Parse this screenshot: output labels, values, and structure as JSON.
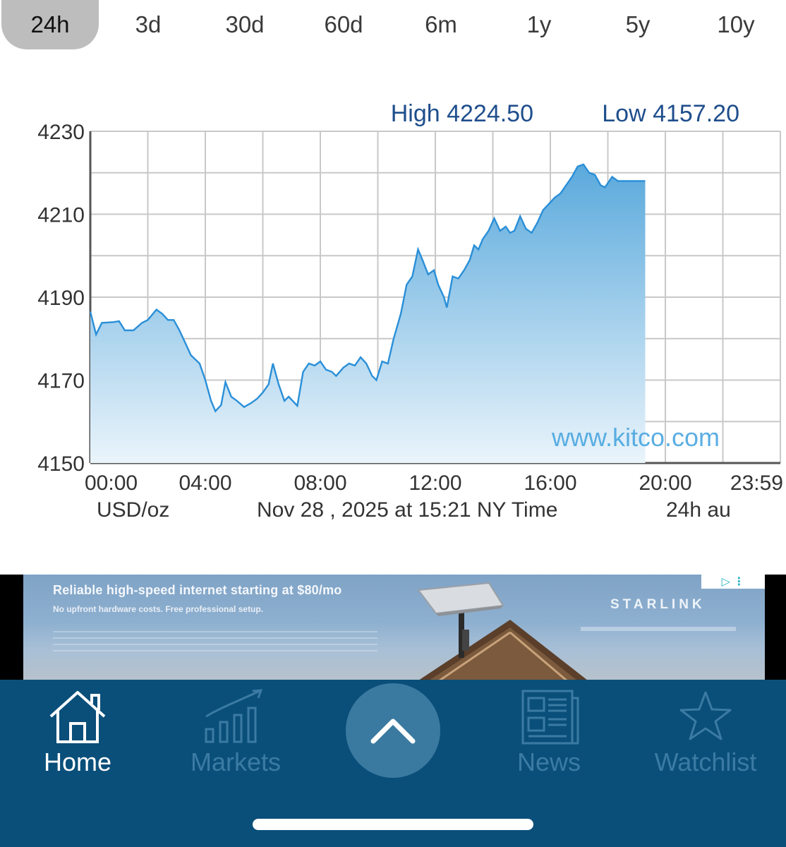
{
  "range_tabs": [
    {
      "label": "24h",
      "active": true
    },
    {
      "label": "3d",
      "active": false
    },
    {
      "label": "30d",
      "active": false
    },
    {
      "label": "60d",
      "active": false
    },
    {
      "label": "6m",
      "active": false
    },
    {
      "label": "1y",
      "active": false
    },
    {
      "label": "5y",
      "active": false
    },
    {
      "label": "10y",
      "active": false
    }
  ],
  "chart": {
    "high_label": "High 4224.50",
    "low_label": "Low 4157.20",
    "watermark": "www.kitco.com",
    "unit_label": "USD/oz",
    "timestamp_label": "Nov 28 , 2025 at 15:21 NY Time",
    "range_label": "24h au",
    "colors": {
      "line": "#2a8fd8",
      "fill_top": "#5aa9dc",
      "fill_bottom": "#eaf4fb",
      "text": "#1f4e8c",
      "grid": "#c8c8c8"
    }
  },
  "chart_data": {
    "type": "area",
    "title": "",
    "xlabel": "",
    "ylabel": "",
    "ylim": [
      4150,
      4230
    ],
    "yticks": [
      4150,
      4170,
      4190,
      4210,
      4230
    ],
    "xlim": [
      0,
      24
    ],
    "xticks": [
      {
        "value": 0,
        "label": "00:00"
      },
      {
        "value": 4,
        "label": "04:00"
      },
      {
        "value": 8,
        "label": "08:00"
      },
      {
        "value": 12,
        "label": "12:00"
      },
      {
        "value": 16,
        "label": "16:00"
      },
      {
        "value": 20,
        "label": "20:00"
      },
      {
        "value": 24,
        "label": "23:59"
      }
    ],
    "x_units": "hours",
    "grid": true,
    "series": [
      {
        "points": [
          [
            0.0,
            4186.5
          ],
          [
            0.2,
            4181
          ],
          [
            0.4,
            4183.8
          ],
          [
            0.8,
            4184
          ],
          [
            1.0,
            4184.2
          ],
          [
            1.2,
            4182
          ],
          [
            1.5,
            4182
          ],
          [
            1.8,
            4183.8
          ],
          [
            2.0,
            4184.5
          ],
          [
            2.3,
            4187
          ],
          [
            2.5,
            4186
          ],
          [
            2.7,
            4184.5
          ],
          [
            2.9,
            4184.5
          ],
          [
            3.1,
            4182
          ],
          [
            3.3,
            4179
          ],
          [
            3.5,
            4176
          ],
          [
            3.8,
            4174
          ],
          [
            4.0,
            4170
          ],
          [
            4.2,
            4165
          ],
          [
            4.35,
            4162.5
          ],
          [
            4.55,
            4164
          ],
          [
            4.7,
            4169.5
          ],
          [
            4.9,
            4166
          ],
          [
            5.1,
            4165
          ],
          [
            5.35,
            4163.5
          ],
          [
            5.6,
            4164.5
          ],
          [
            5.8,
            4165.5
          ],
          [
            6.0,
            4167
          ],
          [
            6.2,
            4169
          ],
          [
            6.35,
            4174
          ],
          [
            6.55,
            4169
          ],
          [
            6.75,
            4165
          ],
          [
            6.9,
            4166
          ],
          [
            7.2,
            4163.8
          ],
          [
            7.4,
            4172
          ],
          [
            7.6,
            4174
          ],
          [
            7.8,
            4173.5
          ],
          [
            8.0,
            4174.5
          ],
          [
            8.2,
            4172.5
          ],
          [
            8.4,
            4172
          ],
          [
            8.55,
            4171
          ],
          [
            8.8,
            4173
          ],
          [
            9.0,
            4174
          ],
          [
            9.2,
            4173.5
          ],
          [
            9.4,
            4175.5
          ],
          [
            9.6,
            4174
          ],
          [
            9.8,
            4171
          ],
          [
            9.95,
            4170
          ],
          [
            10.15,
            4174.5
          ],
          [
            10.35,
            4174
          ],
          [
            10.55,
            4180
          ],
          [
            10.8,
            4186
          ],
          [
            11.0,
            4193
          ],
          [
            11.2,
            4195
          ],
          [
            11.4,
            4201.5
          ],
          [
            11.55,
            4199
          ],
          [
            11.75,
            4195.5
          ],
          [
            11.95,
            4196.5
          ],
          [
            12.1,
            4193
          ],
          [
            12.3,
            4190
          ],
          [
            12.4,
            4187.5
          ],
          [
            12.6,
            4195
          ],
          [
            12.8,
            4194.5
          ],
          [
            13.0,
            4196.5
          ],
          [
            13.2,
            4199
          ],
          [
            13.35,
            4202.5
          ],
          [
            13.5,
            4201.5
          ],
          [
            13.65,
            4204
          ],
          [
            13.85,
            4206
          ],
          [
            14.05,
            4209
          ],
          [
            14.25,
            4206
          ],
          [
            14.45,
            4207
          ],
          [
            14.6,
            4205.5
          ],
          [
            14.75,
            4206
          ],
          [
            14.95,
            4209.5
          ],
          [
            15.15,
            4206.5
          ],
          [
            15.35,
            4205.5
          ],
          [
            15.55,
            4208
          ],
          [
            15.75,
            4211
          ],
          [
            15.95,
            4212.5
          ],
          [
            16.15,
            4214
          ],
          [
            16.35,
            4215
          ],
          [
            16.55,
            4217
          ],
          [
            16.75,
            4219
          ],
          [
            16.95,
            4221.5
          ],
          [
            17.15,
            4222
          ],
          [
            17.35,
            4220
          ],
          [
            17.55,
            4219.5
          ],
          [
            17.75,
            4217
          ],
          [
            17.9,
            4216.5
          ],
          [
            18.15,
            4219
          ],
          [
            18.35,
            4218
          ],
          [
            18.6,
            4218
          ],
          [
            19.0,
            4218
          ],
          [
            19.3,
            4218
          ]
        ]
      }
    ]
  },
  "ad": {
    "headline": "Reliable high-speed internet starting at $80/mo",
    "subline": "No upfront hardware costs. Free professional setup.",
    "brand": "STARLINK",
    "choices": "▷ ⋮"
  },
  "bottom_nav": {
    "items": [
      {
        "label": "Home",
        "icon": "house-icon",
        "active": true
      },
      {
        "label": "Markets",
        "icon": "chart-bars-icon",
        "active": false
      },
      {
        "label": "News",
        "icon": "newspaper-icon",
        "active": false
      },
      {
        "label": "Watchlist",
        "icon": "star-icon",
        "active": false
      }
    ],
    "center_icon": "chevron-up-icon",
    "colors": {
      "background": "#0a4f7a",
      "active": "#ffffff",
      "inactive": "#3b7ba3",
      "center": "#3a7aa0"
    }
  }
}
